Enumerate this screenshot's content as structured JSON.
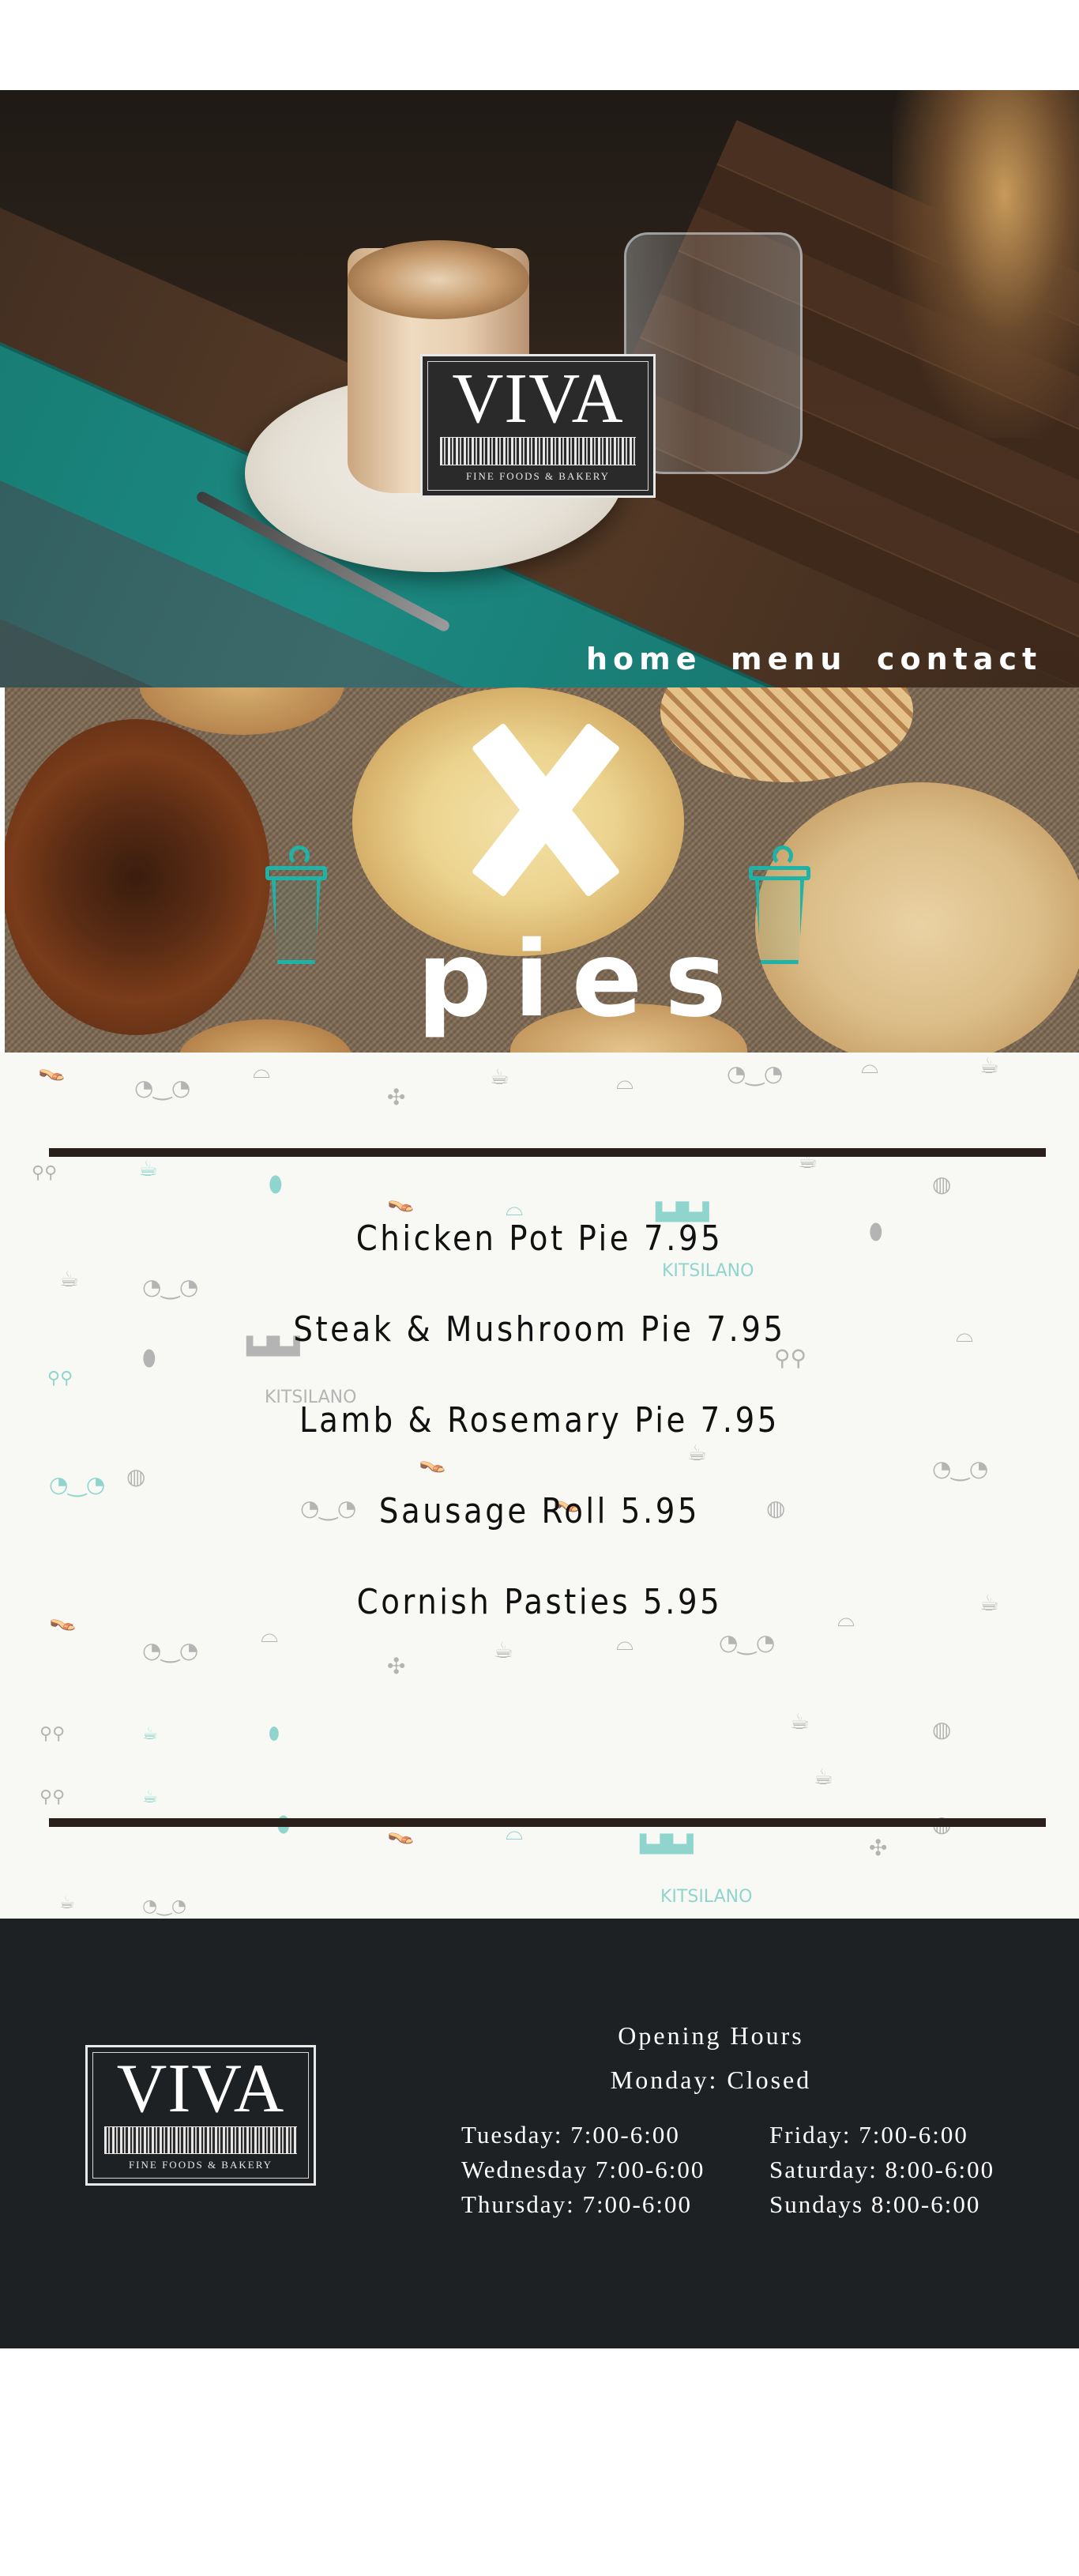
{
  "brand": {
    "name": "VIVA",
    "tagline": "FINE FOODS & BAKERY"
  },
  "nav": {
    "items": [
      "home",
      "menu",
      "contact"
    ]
  },
  "banner": {
    "heading": "pies"
  },
  "menu": {
    "items": [
      "Chicken Pot Pie 7.95",
      "Steak & Mushroom Pie 7.95",
      "Lamb & Rosemary Pie 7.95",
      "Sausage Roll 5.95",
      "Cornish Pasties 5.95"
    ],
    "pattern_labels": [
      "KITSILANO",
      "KITSILANO",
      "KITSILANO"
    ]
  },
  "footer": {
    "hours_title": "Opening Hours",
    "closed_day": "Monday: Closed",
    "hours_left": [
      "Tuesday: 7:00-6:00",
      "Wednesday 7:00-6:00",
      "Thursday: 7:00-6:00"
    ],
    "hours_right": [
      "Friday: 7:00-6:00",
      "Saturday: 8:00-6:00",
      "Sundays 8:00-6:00"
    ]
  },
  "colors": {
    "accent_teal": "#1fb2a6",
    "footer_bg": "#1e2123",
    "menu_bg": "#f8f8f4",
    "rule": "#2a1f1a"
  }
}
